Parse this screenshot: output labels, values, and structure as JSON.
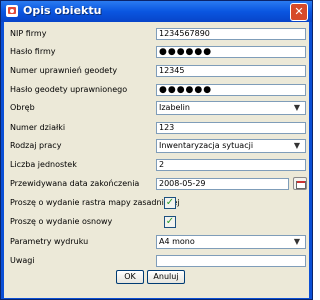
{
  "window": {
    "title": "Opis obiektu",
    "close_symbol": "✕"
  },
  "form": {
    "nip": {
      "label": "NIP firmy",
      "value": "1234567890"
    },
    "haslo_firmy": {
      "label": "Hasło firmy",
      "value": "●●●●●●"
    },
    "numer_uprawnien": {
      "label": "Numer uprawnień geodety",
      "value": "12345"
    },
    "haslo_geodety": {
      "label": "Hasło geodety uprawnionego",
      "value": "●●●●●●"
    },
    "obreb": {
      "label": "Obręb",
      "value": "Izabelin"
    },
    "numer_dzialki": {
      "label": "Numer działki",
      "value": "123"
    },
    "rodzaj_pracy": {
      "label": "Rodzaj pracy",
      "value": "Inwentaryzacja sytuacji"
    },
    "liczba_jednostek": {
      "label": "Liczba jednostek",
      "value": "2"
    },
    "data_zakonczenia": {
      "label": "Przewidywana data zakończenia",
      "value": "2008-05-29"
    },
    "rastr": {
      "label": "Proszę o wydanie rastra mapy zasadniczej",
      "checked": true
    },
    "osnowa": {
      "label": "Proszę o wydanie osnowy",
      "checked": true
    },
    "parametry": {
      "label": "Parametry wydruku",
      "value": "A4 mono"
    },
    "uwagi": {
      "label": "Uwagi",
      "value": ""
    }
  },
  "buttons": {
    "ok": "OK",
    "cancel": "Anuluj"
  },
  "icons": {
    "dropdown_arrow": "▼",
    "check_mark": "✓"
  }
}
